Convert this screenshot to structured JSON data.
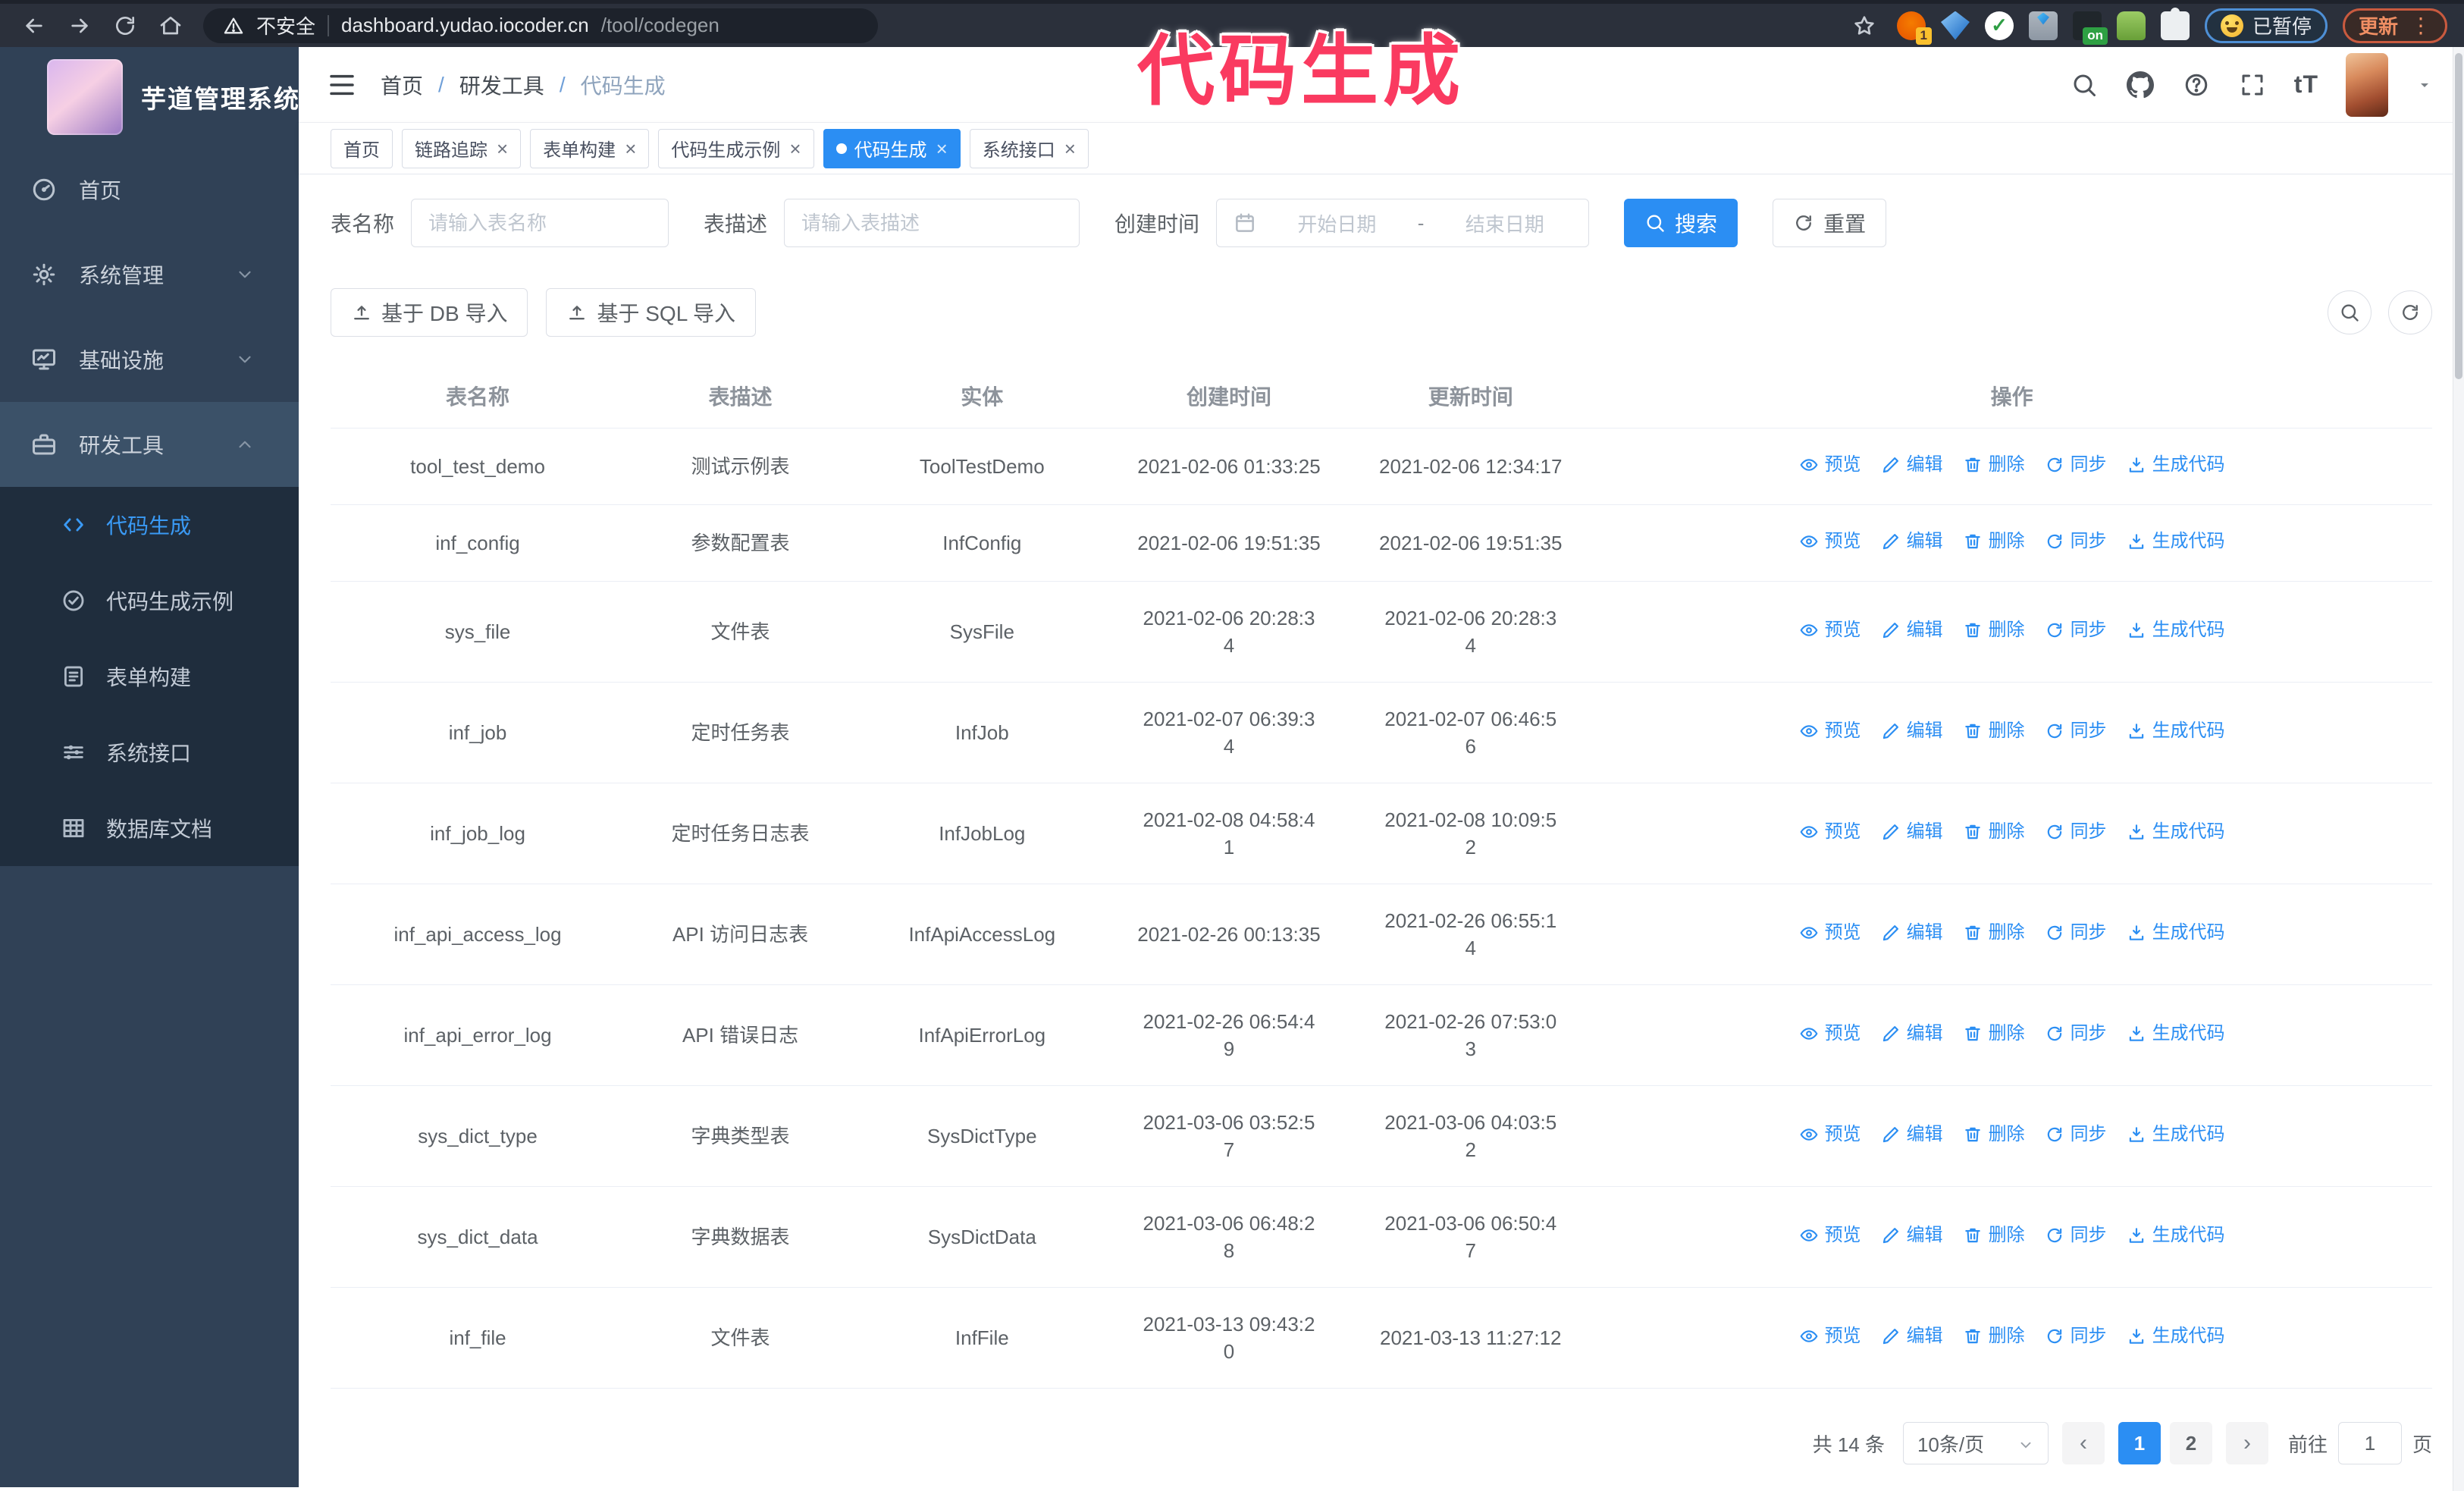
{
  "colors": {
    "accent": "#2b8ef3",
    "sidebar_bg": "#304156",
    "submenu_bg": "#1f2d3d",
    "annotation": "#fa3a60",
    "chrome_bg": "#2b303b"
  },
  "annotation": {
    "title": "代码生成"
  },
  "browser": {
    "security_label": "不安全",
    "url_host": "dashboard.yudao.iocoder.cn",
    "url_path": "/tool/codegen",
    "paused_label": "已暂停",
    "update_label": "更新",
    "extensions": [
      {
        "id": "ext-orange",
        "badge": "1"
      },
      {
        "id": "ext-gem",
        "badge": ""
      },
      {
        "id": "ext-green-check",
        "badge": ""
      },
      {
        "id": "ext-grid-gem",
        "badge": ""
      },
      {
        "id": "ext-dark-on",
        "badge": "on"
      },
      {
        "id": "ext-green-bot",
        "badge": ""
      },
      {
        "id": "ext-puzzle",
        "badge": ""
      }
    ]
  },
  "ui": {
    "close_glyph": "×",
    "kebab_glyph": "⋮",
    "prev_glyph": "‹",
    "next_glyph": "›",
    "font_size_glyph": "tT",
    "range_separator": "-"
  },
  "sidebar": {
    "app_title": "芋道管理系统",
    "items": [
      {
        "id": "home",
        "icon": "dashboard",
        "label": "首页",
        "expandable": false,
        "expanded": false,
        "highlight": false
      },
      {
        "id": "system",
        "icon": "gear",
        "label": "系统管理",
        "expandable": true,
        "expanded": false,
        "highlight": false
      },
      {
        "id": "infra",
        "icon": "monitor",
        "label": "基础设施",
        "expandable": true,
        "expanded": false,
        "highlight": false
      },
      {
        "id": "devtools",
        "icon": "toolbox",
        "label": "研发工具",
        "expandable": true,
        "expanded": true,
        "highlight": true
      }
    ],
    "submenu": [
      {
        "id": "codegen",
        "icon": "code",
        "label": "代码生成",
        "active": true
      },
      {
        "id": "codegen-example",
        "icon": "badge",
        "label": "代码生成示例",
        "active": false
      },
      {
        "id": "form-builder",
        "icon": "form",
        "label": "表单构建",
        "active": false
      },
      {
        "id": "system-api",
        "icon": "sliders",
        "label": "系统接口",
        "active": false
      },
      {
        "id": "db-doc",
        "icon": "grid",
        "label": "数据库文档",
        "active": false
      }
    ]
  },
  "navbar": {
    "breadcrumb": [
      "首页",
      "研发工具",
      "代码生成"
    ],
    "separator": "/"
  },
  "tags": [
    {
      "id": "home",
      "label": "首页",
      "closable": false,
      "active": false
    },
    {
      "id": "tracing",
      "label": "链路追踪",
      "closable": true,
      "active": false
    },
    {
      "id": "form-builder",
      "label": "表单构建",
      "closable": true,
      "active": false
    },
    {
      "id": "codegen-example",
      "label": "代码生成示例",
      "closable": true,
      "active": false
    },
    {
      "id": "codegen",
      "label": "代码生成",
      "closable": true,
      "active": true
    },
    {
      "id": "system-api",
      "label": "系统接口",
      "closable": true,
      "active": false
    }
  ],
  "search": {
    "name_label": "表名称",
    "name_placeholder": "请输入表名称",
    "desc_label": "表描述",
    "desc_placeholder": "请输入表描述",
    "time_label": "创建时间",
    "start_placeholder": "开始日期",
    "end_placeholder": "结束日期",
    "search_button": "搜索",
    "reset_button": "重置"
  },
  "toolbar": {
    "import_db_label": "基于 DB 导入",
    "import_sql_label": "基于 SQL 导入"
  },
  "table": {
    "columns": [
      "表名称",
      "表描述",
      "实体",
      "创建时间",
      "更新时间",
      "操作"
    ],
    "actions": [
      {
        "id": "preview",
        "icon": "eye",
        "label": "预览"
      },
      {
        "id": "edit",
        "icon": "edit",
        "label": "编辑"
      },
      {
        "id": "delete",
        "icon": "trash",
        "label": "删除"
      },
      {
        "id": "sync",
        "icon": "sync",
        "label": "同步"
      },
      {
        "id": "generate",
        "icon": "download",
        "label": "生成代码"
      }
    ],
    "rows": [
      {
        "name": "tool_test_demo",
        "desc": "测试示例表",
        "entity": "ToolTestDemo",
        "created": "2021-02-06 01:33:25",
        "updated": "2021-02-06 12:34:17"
      },
      {
        "name": "inf_config",
        "desc": "参数配置表",
        "entity": "InfConfig",
        "created": "2021-02-06 19:51:35",
        "updated": "2021-02-06 19:51:35"
      },
      {
        "name": "sys_file",
        "desc": "文件表",
        "entity": "SysFile",
        "created": "2021-02-06 20:28:3\n4",
        "updated": "2021-02-06 20:28:3\n4"
      },
      {
        "name": "inf_job",
        "desc": "定时任务表",
        "entity": "InfJob",
        "created": "2021-02-07 06:39:3\n4",
        "updated": "2021-02-07 06:46:5\n6"
      },
      {
        "name": "inf_job_log",
        "desc": "定时任务日志表",
        "entity": "InfJobLog",
        "created": "2021-02-08 04:58:4\n1",
        "updated": "2021-02-08 10:09:5\n2"
      },
      {
        "name": "inf_api_access_log",
        "desc": "API 访问日志表",
        "entity": "InfApiAccessLog",
        "created": "2021-02-26 00:13:35",
        "updated": "2021-02-26 06:55:1\n4"
      },
      {
        "name": "inf_api_error_log",
        "desc": "API 错误日志",
        "entity": "InfApiErrorLog",
        "created": "2021-02-26 06:54:4\n9",
        "updated": "2021-02-26 07:53:0\n3"
      },
      {
        "name": "sys_dict_type",
        "desc": "字典类型表",
        "entity": "SysDictType",
        "created": "2021-03-06 03:52:5\n7",
        "updated": "2021-03-06 04:03:5\n2"
      },
      {
        "name": "sys_dict_data",
        "desc": "字典数据表",
        "entity": "SysDictData",
        "created": "2021-03-06 06:48:2\n8",
        "updated": "2021-03-06 06:50:4\n7"
      },
      {
        "name": "inf_file",
        "desc": "文件表",
        "entity": "InfFile",
        "created": "2021-03-13 09:43:2\n0",
        "updated": "2021-03-13 11:27:12"
      }
    ]
  },
  "pagination": {
    "total": "共 14 条",
    "page_size": "10条/页",
    "pages": [
      "1",
      "2"
    ],
    "active_page": "1",
    "goto_label": "前往",
    "goto_value": "1",
    "goto_suffix": "页"
  }
}
